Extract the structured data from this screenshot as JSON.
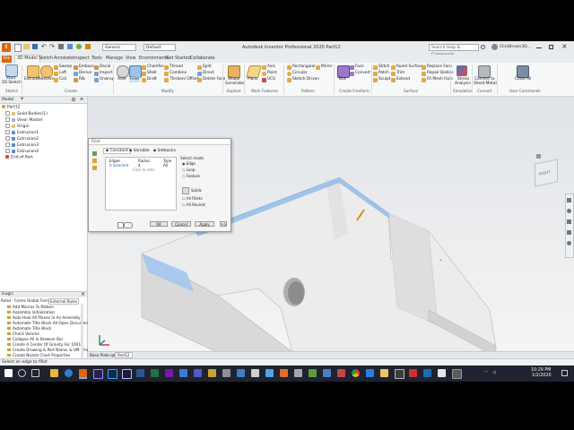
{
  "app_title": "Autodesk Inventor Professional 2020    Part12",
  "qat": {
    "appearance": "Generic",
    "style": "Default"
  },
  "search_placeholder": "Search Help & Commands...",
  "user": "ClintBrown3D...",
  "tabs": [
    "3D Model",
    "Sketch",
    "Annotate",
    "Inspect",
    "Tools",
    "Manage",
    "View",
    "Environments",
    "Get Started",
    "Collaborate"
  ],
  "file_tab": "File",
  "ribbon": {
    "sketch": [
      "Start",
      "2D Sketch"
    ],
    "create": {
      "big": [
        "Extrude",
        "Revolve"
      ],
      "small": [
        "Sweep",
        "Loft",
        "Coil",
        "Emboss",
        "Derive",
        "Rib",
        "Decal",
        "Import",
        "Unwrap"
      ]
    },
    "modify": {
      "big": [
        "Hole",
        "Fillet"
      ],
      "small": [
        "Chamfer",
        "Shell",
        "Draft",
        "Thread",
        "Combine",
        "Thicken/ Offset",
        "Split",
        "Direct",
        "Delete Face"
      ]
    },
    "explore": [
      "Shape",
      "Generator"
    ],
    "work_features": {
      "big": [
        "Plane"
      ],
      "small": [
        "Axis",
        "Point",
        "UCS"
      ]
    },
    "pattern": [
      "Rectangular",
      "Circular",
      "Sketch Driven",
      "Mirror"
    ],
    "freeform": {
      "big": [
        "Box"
      ],
      "small": [
        "Face",
        "Convert"
      ]
    },
    "surface": [
      "Stitch",
      "Patch",
      "Sculpt",
      "Ruled Surface",
      "Trim",
      "Extend",
      "Replace Face",
      "Repair Bodies",
      "Fit Mesh Face"
    ],
    "simulation": [
      "Stress",
      "Analysis"
    ],
    "convert": [
      "Convert to",
      "Sheet Metal"
    ],
    "user_commands": [
      "Close All"
    ],
    "groups": [
      "Sketch",
      "Create",
      "Modify",
      "Explore",
      "Work Features",
      "Pattern",
      "Create Freeform",
      "Surface",
      "Simulation",
      "Convert",
      "User Commands"
    ]
  },
  "browser": {
    "header": "Model",
    "items": [
      "Part12",
      "Solid Bodies(1)",
      "View: Master",
      "Origin",
      "Extrusion1",
      "Extrusion2",
      "Extrusion3",
      "Extrusion4",
      "End of Part"
    ]
  },
  "ilogic": {
    "header": "iLogic",
    "tabs": [
      "Rules",
      "Forms",
      "Global Forms",
      "External Rules"
    ],
    "rules": [
      "Add Macros To Ribbon",
      "Assembly Initialization",
      "Auto Heal All Planes In An Assembly",
      "Automate Title Block All Open Documents",
      "Automate Title Block",
      "Check Volume",
      "Collapse All In Browser Bar",
      "Create A Center Of Gravity For 1001",
      "Create Drawing & Part Name, & UM (Propert",
      "Create Nozzle Chart Properties"
    ]
  },
  "dialog": {
    "title": "Fillet",
    "tabs": [
      "Constant",
      "Variable",
      "Setbacks"
    ],
    "columns": [
      "Edges",
      "Radius",
      "Type"
    ],
    "row": {
      "edges": "0 Selected",
      "radius": "4",
      "type": "All"
    },
    "click_to_add": "Click to add",
    "select_mode_label": "Select mode",
    "select_modes": [
      "Edge",
      "Loop",
      "Feature"
    ],
    "solids": "Solids",
    "checks": [
      "All Fillets",
      "All Rounds"
    ],
    "buttons": {
      "ok": "OK",
      "cancel": "Cancel",
      "apply": "Apply",
      "more": ">>"
    }
  },
  "doc_tabs": [
    "Base Plate.ipt",
    "Part12"
  ],
  "status_text": "Select an edge to fillet",
  "viewcube_label": "RIGHT",
  "clock": {
    "time": "10:29 PM",
    "date": "1/2/2020"
  },
  "colors": {
    "accent": "#d86813",
    "selection": "#7fb2e8",
    "part": "#ececec",
    "taskbar": "#1f2330"
  }
}
